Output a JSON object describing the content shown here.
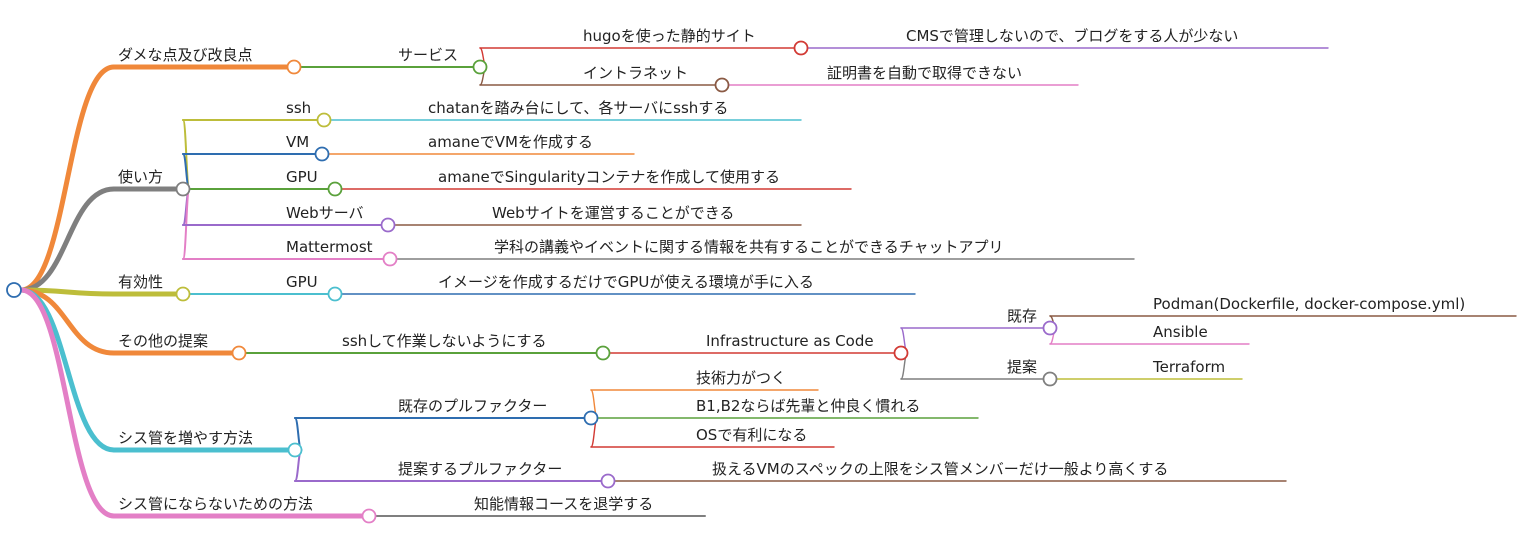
{
  "mindmap": {
    "root": {
      "children": [
        {
          "label": "ダメな点及び改良点",
          "color": "#f0883a",
          "children": [
            {
              "label": "サービス",
              "color": "#5aa13b",
              "children": [
                {
                  "label": "hugoを使った静的サイト",
                  "color": "#d23a34",
                  "children": [
                    {
                      "label": "CMSで管理しないので、ブログをする人が少ない",
                      "color": "#9a6acb"
                    }
                  ]
                },
                {
                  "label": "イントラネット",
                  "color": "#8a5a44",
                  "children": [
                    {
                      "label": "証明書を自動で取得できない",
                      "color": "#e37fc6"
                    }
                  ]
                }
              ]
            }
          ]
        },
        {
          "label": "使い方",
          "color": "#7f7f7f",
          "children": [
            {
              "label": "ssh",
              "color": "#bdbd3a",
              "children": [
                {
                  "label": "chatanを踏み台にして、各サーバにsshする",
                  "color": "#4bbfcf"
                }
              ]
            },
            {
              "label": "VM",
              "color": "#2e6db0",
              "children": [
                {
                  "label": "amaneでVMを作成する",
                  "color": "#f0883a"
                }
              ]
            },
            {
              "label": "GPU",
              "color": "#5aa13b",
              "children": [
                {
                  "label": "amaneでSingularityコンテナを作成して使用する",
                  "color": "#d23a34"
                }
              ]
            },
            {
              "label": "Webサーバ",
              "color": "#9a6acb",
              "children": [
                {
                  "label": "Webサイトを運営することができる",
                  "color": "#8a5a44"
                }
              ]
            },
            {
              "label": "Mattermost",
              "color": "#e37fc6",
              "children": [
                {
                  "label": "学科の講義やイベントに関する情報を共有することができるチャットアプリ",
                  "color": "#7f7f7f"
                }
              ]
            }
          ]
        },
        {
          "label": "有効性",
          "color": "#bdbd3a",
          "children": [
            {
              "label": "GPU",
              "color": "#4bbfcf",
              "children": [
                {
                  "label": "イメージを作成するだけでGPUが使える環境が手に入る",
                  "color": "#2e6db0"
                }
              ]
            }
          ]
        },
        {
          "label": "その他の提案",
          "color": "#f0883a",
          "children": [
            {
              "label": "sshして作業しないようにする",
              "color": "#5aa13b",
              "children": [
                {
                  "label": "Infrastructure as Code",
                  "color": "#d23a34",
                  "children": [
                    {
                      "label": "既存",
                      "color": "#9a6acb",
                      "children": [
                        {
                          "label": "Podman(Dockerfile, docker-compose.yml)",
                          "color": "#8a5a44"
                        },
                        {
                          "label": "Ansible",
                          "color": "#e37fc6"
                        }
                      ]
                    },
                    {
                      "label": "提案",
                      "color": "#7f7f7f",
                      "children": [
                        {
                          "label": "Terraform",
                          "color": "#bdbd3a"
                        }
                      ]
                    }
                  ]
                }
              ]
            }
          ]
        },
        {
          "label": "シス管を増やす方法",
          "color": "#4bbfcf",
          "children": [
            {
              "label": "既存のプルファクター",
              "color": "#2e6db0",
              "children": [
                {
                  "label": "技術力がつく",
                  "color": "#f0883a"
                },
                {
                  "label": "B1,B2ならば先輩と仲良く慣れる",
                  "color": "#5aa13b"
                },
                {
                  "label": "OSで有利になる",
                  "color": "#d23a34"
                }
              ]
            },
            {
              "label": "提案するプルファクター",
              "color": "#9a6acb",
              "children": [
                {
                  "label": "扱えるVMのスペックの上限をシス管メンバーだけ一般より高くする",
                  "color": "#8a5a44"
                }
              ]
            }
          ]
        },
        {
          "label": "シス管にならないための方法",
          "color": "#e37fc6",
          "children": [
            {
              "label": "知能情報コースを退学する",
              "color": "#7f7f7f"
            }
          ]
        }
      ]
    }
  }
}
